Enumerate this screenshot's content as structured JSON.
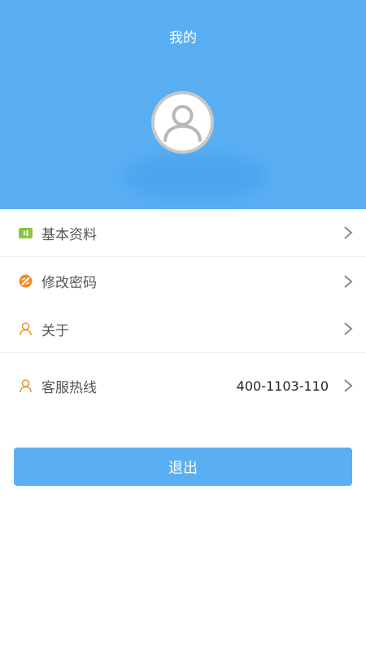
{
  "header": {
    "title": "我的"
  },
  "menu": {
    "items": [
      {
        "label": "基本资料",
        "icon": "profile-card-icon",
        "color": "#8cc63f"
      },
      {
        "label": "修改密码",
        "icon": "password-edit-icon",
        "color": "#f08c2a"
      },
      {
        "label": "关于",
        "icon": "person-outline-icon",
        "color": "#e29a3a"
      },
      {
        "label": "客服热线",
        "icon": "person-outline-icon",
        "color": "#e29a3a",
        "value": "400-1103-110"
      }
    ]
  },
  "logout": {
    "label": "退出"
  },
  "colors": {
    "header_bg": "#5aaff3",
    "button_bg": "#5aaff3"
  }
}
